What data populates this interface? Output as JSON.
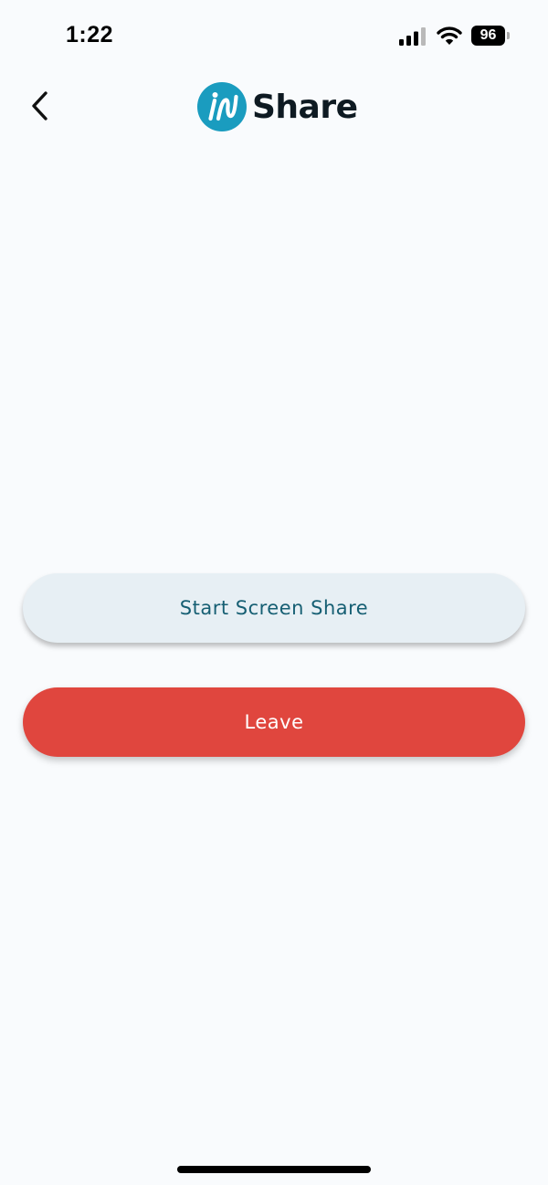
{
  "status_bar": {
    "time": "1:22",
    "battery_level": "96",
    "signal_icon": "cellular-signal-icon",
    "wifi_icon": "wifi-icon"
  },
  "header": {
    "back_icon": "chevron-left-icon",
    "logo_text": "Share",
    "logo_color": "#1a9cbf"
  },
  "actions": {
    "start_share_label": "Start Screen Share",
    "leave_label": "Leave"
  },
  "colors": {
    "background": "#f9fbfd",
    "share_button_bg": "#e7eff4",
    "share_button_text": "#165f73",
    "leave_button_bg": "#e0463e",
    "leave_button_text": "#ffffff"
  }
}
